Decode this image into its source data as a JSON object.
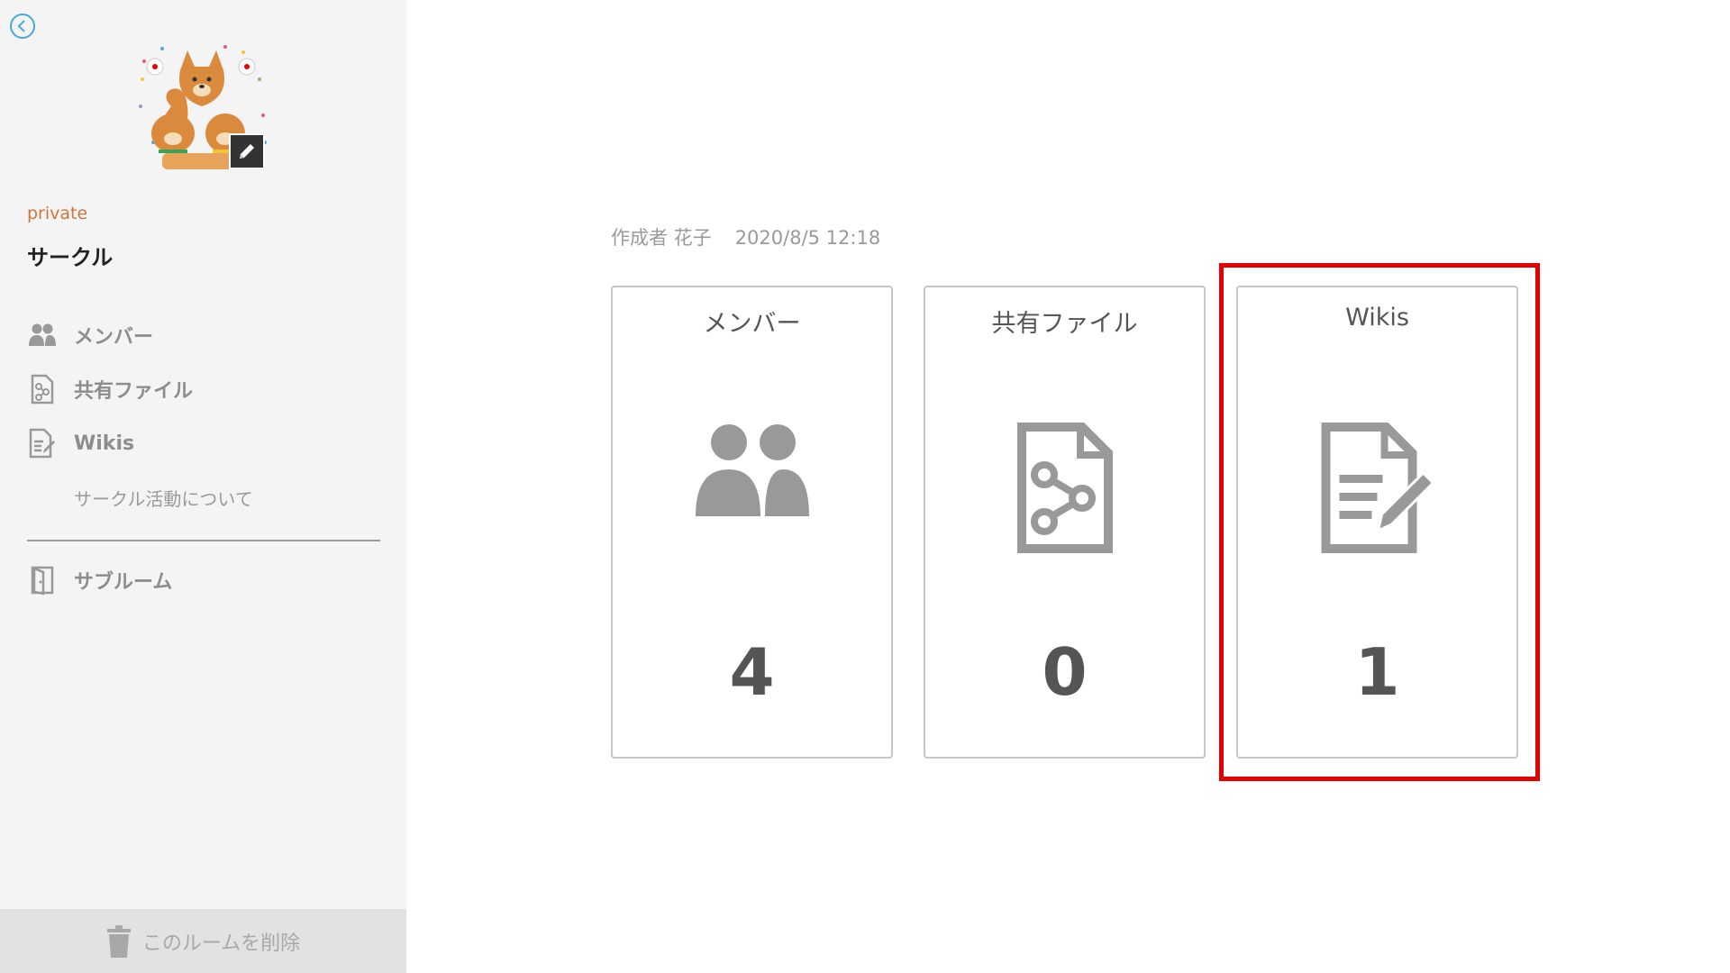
{
  "sidebar": {
    "privacy": "private",
    "room_name": "サークル",
    "nav": {
      "members": "メンバー",
      "files": "共有ファイル",
      "wikis": "Wikis",
      "wiki_page": "サークル活動について",
      "subroom": "サブルーム"
    },
    "delete_label": "このルームを削除"
  },
  "main": {
    "author": "作成者 花子",
    "created_at": "2020/8/5 12:18",
    "cards": [
      {
        "title": "メンバー",
        "count": "4",
        "icon": "members-icon"
      },
      {
        "title": "共有ファイル",
        "count": "0",
        "icon": "shared-file-icon"
      },
      {
        "title": "Wikis",
        "count": "1",
        "icon": "wiki-doc-icon"
      }
    ]
  },
  "colors": {
    "sidebar_bg": "#f4f4f4",
    "privacy_accent": "#d0753a",
    "icon_gray": "#999999",
    "highlight_red": "#e60000"
  }
}
